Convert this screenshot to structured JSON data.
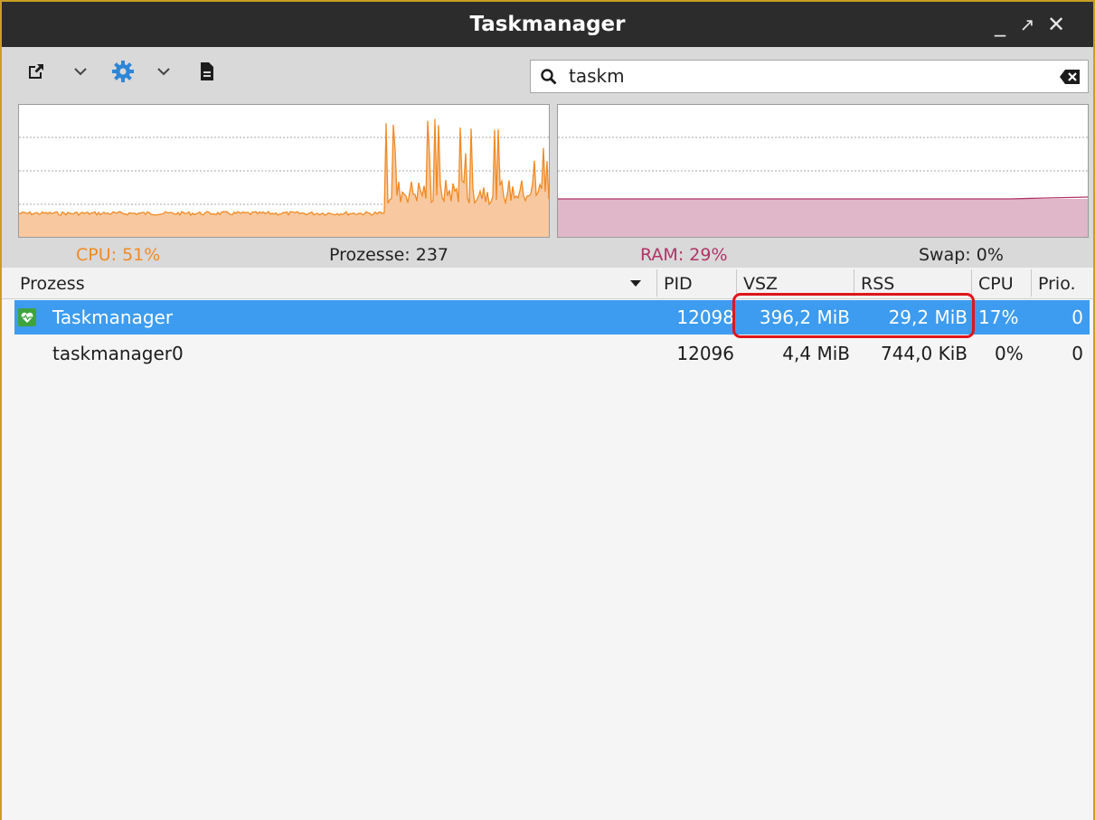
{
  "window": {
    "title": "Taskmanager"
  },
  "window_controls": {
    "minimize": "_",
    "maximize": "↗",
    "close": "✕"
  },
  "toolbar": {
    "icons": [
      "open-external-icon",
      "chevron-down-icon",
      "gear-icon",
      "chevron-down-icon",
      "document-icon"
    ]
  },
  "search": {
    "value": "taskm",
    "placeholder": ""
  },
  "stats": {
    "cpu": "CPU: 51%",
    "processes": "Prozesse: 237",
    "ram": "RAM: 29%",
    "swap": "Swap: 0%"
  },
  "colors": {
    "cpu": "#f08a24",
    "cpu_fill": "#f8c9a0",
    "ram": "#b03466",
    "ram_fill": "#e0b7c8",
    "selection": "#3d9cf0",
    "highlight": "#e0151b"
  },
  "table": {
    "columns": [
      "Prozess",
      "PID",
      "VSZ",
      "RSS",
      "CPU",
      "Prio."
    ],
    "rows": [
      {
        "name": "Taskmanager",
        "pid": "12098",
        "vsz": "396,2 MiB",
        "rss": "29,2 MiB",
        "cpu": "17%",
        "prio": "0",
        "selected": true,
        "icon": "heart-icon"
      },
      {
        "name": "taskmanager0",
        "pid": "12096",
        "vsz": "4,4 MiB",
        "rss": "744,0 KiB",
        "cpu": "0%",
        "prio": "0",
        "selected": false
      }
    ]
  }
}
